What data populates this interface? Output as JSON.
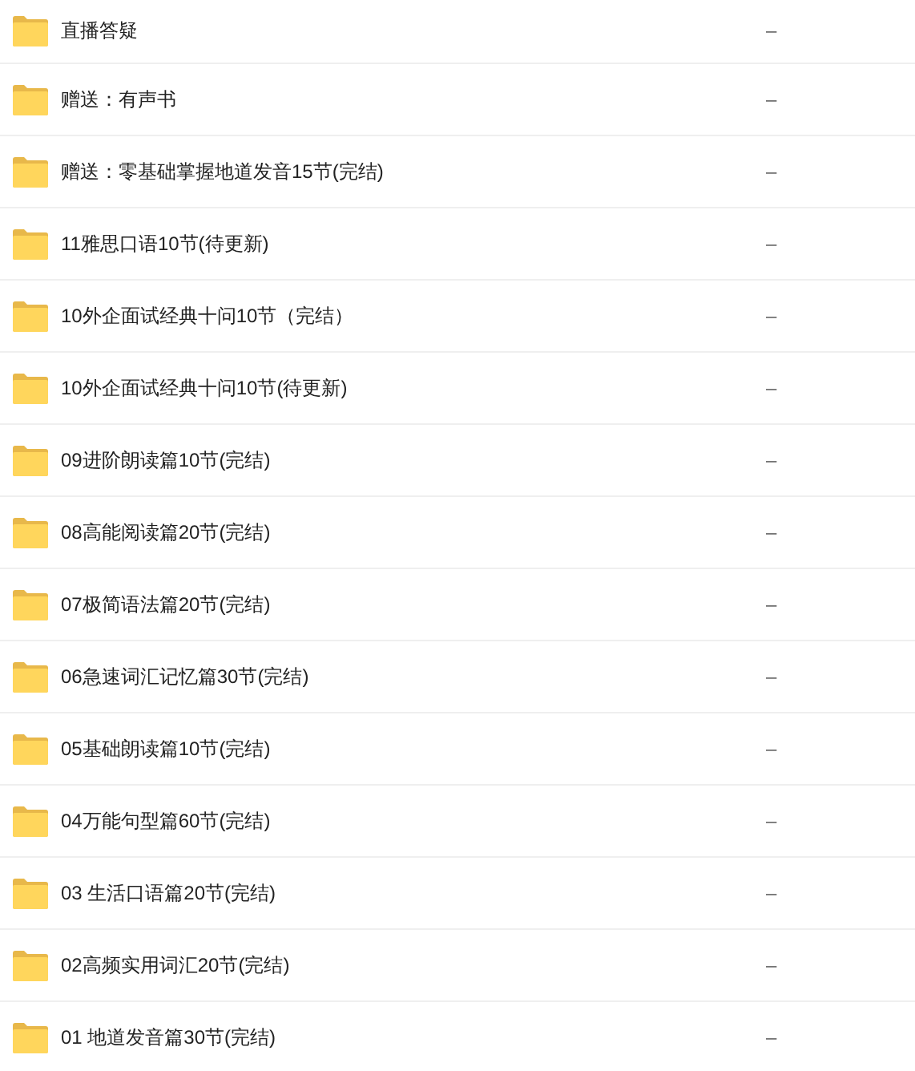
{
  "files": [
    {
      "name": "直播答疑",
      "size": "–"
    },
    {
      "name": "赠送：有声书",
      "size": "–"
    },
    {
      "name": "赠送：零基础掌握地道发音15节(完结)",
      "size": "–"
    },
    {
      "name": "11雅思口语10节(待更新)",
      "size": "–"
    },
    {
      "name": "10外企面试经典十问10节（完结）",
      "size": "–"
    },
    {
      "name": "10外企面试经典十问10节(待更新)",
      "size": "–"
    },
    {
      "name": "09进阶朗读篇10节(完结)",
      "size": "–"
    },
    {
      "name": "08高能阅读篇20节(完结)",
      "size": "–"
    },
    {
      "name": "07极简语法篇20节(完结)",
      "size": "–"
    },
    {
      "name": "06急速词汇记忆篇30节(完结)",
      "size": "–"
    },
    {
      "name": "05基础朗读篇10节(完结)",
      "size": "–"
    },
    {
      "name": "04万能句型篇60节(完结)",
      "size": "–"
    },
    {
      "name": "03 生活口语篇20节(完结)",
      "size": "–"
    },
    {
      "name": "02高频实用词汇20节(完结)",
      "size": "–"
    },
    {
      "name": "01 地道发音篇30节(完结)",
      "size": "–"
    }
  ]
}
